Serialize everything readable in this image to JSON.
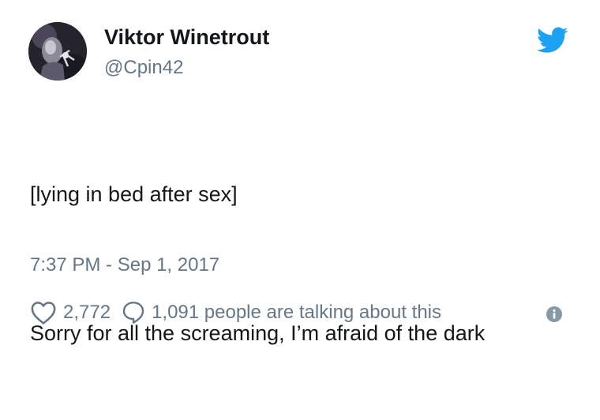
{
  "author": {
    "display_name": "Viktor Winetrout",
    "handle": "@Cpin42",
    "avatar_icon": "profile-avatar-icon"
  },
  "brand": {
    "icon": "twitter-bird-icon",
    "color": "#1da1f2"
  },
  "tweet": {
    "line1": "[lying in bed after sex]",
    "line2": "Sorry for all the screaming, I’m afraid of the dark",
    "timestamp": "7:37 PM - Sep 1, 2017"
  },
  "engagement": {
    "likes": "2,772",
    "replies_text": "1,091 people are talking about this",
    "like_icon": "heart-icon",
    "reply_icon": "speech-bubble-icon",
    "info_icon": "info-icon"
  },
  "colors": {
    "text": "#14171a",
    "secondary": "#657786"
  }
}
